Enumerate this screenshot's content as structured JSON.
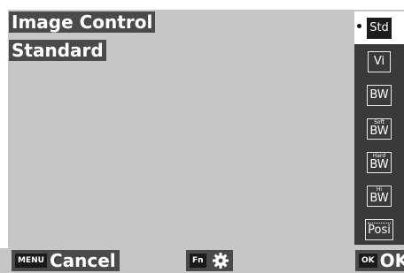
{
  "header": {
    "title": "Image Control",
    "style_name": "Standard"
  },
  "side_panel": {
    "items": [
      {
        "small": "",
        "main": "Std",
        "selected": true,
        "icon": "standard-style-icon"
      },
      {
        "small": "",
        "main": "Vi",
        "selected": false,
        "icon": "vivid-style-icon"
      },
      {
        "small": "",
        "main": "BW",
        "selected": false,
        "icon": "bw-style-icon"
      },
      {
        "small": "Soft",
        "main": "BW",
        "selected": false,
        "icon": "soft-bw-style-icon"
      },
      {
        "small": "Hard",
        "main": "BW",
        "selected": false,
        "icon": "hard-bw-style-icon"
      },
      {
        "small": "Hi",
        "main": "BW",
        "selected": false,
        "icon": "hi-bw-style-icon"
      },
      {
        "small": "",
        "main": "Posi",
        "selected": false,
        "icon": "posi-style-icon"
      }
    ]
  },
  "footer": {
    "menu_key": "MENU",
    "cancel_label": "Cancel",
    "fn_key": "Fn",
    "settings_icon": "gear-icon",
    "ok_key": "OK",
    "ok_label": "OK"
  },
  "colors": {
    "background": "#c6c6c6",
    "label_bg": "#4a4a4a",
    "panel_bg": "#3a3a3a",
    "selected_bg": "#ffffff"
  }
}
